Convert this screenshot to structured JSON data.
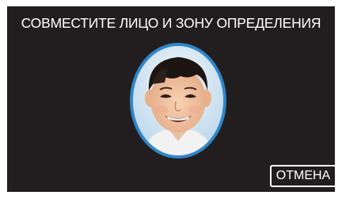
{
  "screen": {
    "instruction": "СОВМЕСТИТЕ ЛИЦО И ЗОНУ ОПРЕДЕЛЕНИЯ",
    "cancel_label": "ОТМЕНА",
    "face_zone_image": "child-face-photo",
    "colors": {
      "background": "#221e1f",
      "face_zone_border": "#2f86c8",
      "text": "#ffffff"
    }
  }
}
